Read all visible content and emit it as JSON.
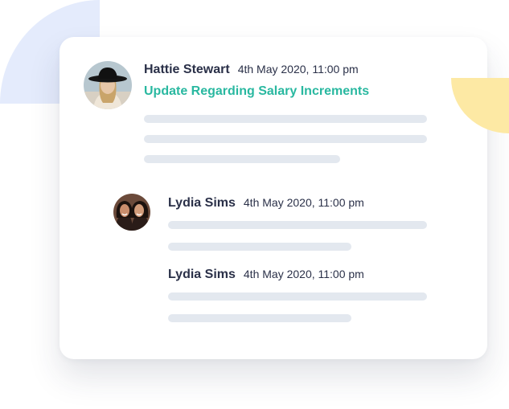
{
  "thread": {
    "message": {
      "author": "Hattie Stewart",
      "timestamp": "4th May 2020, 11:00 pm",
      "subject": "Update Regarding Salary Increments"
    },
    "replies": [
      {
        "author": "Lydia Sims",
        "timestamp": "4th May 2020, 11:00 pm"
      },
      {
        "author": "Lydia Sims",
        "timestamp": "4th May 2020, 11:00 pm"
      }
    ]
  },
  "colors": {
    "subject": "#29b8a0",
    "text": "#2a3048",
    "placeholder_line": "#e3e8ef",
    "deco_blue": "#e4ebfc",
    "deco_yellow": "#fde9a4"
  },
  "icons": [
    "avatar-hattie-stewart",
    "avatar-lydia-sims"
  ]
}
